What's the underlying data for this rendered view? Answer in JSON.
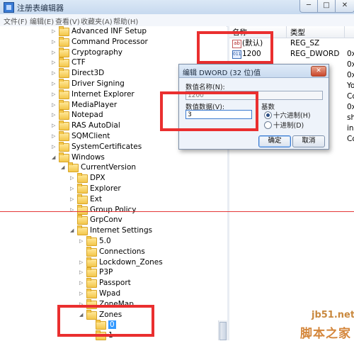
{
  "window": {
    "title": "注册表编辑器",
    "min": "─",
    "max": "□",
    "close": "✕"
  },
  "menu": [
    "文件(F)",
    "编辑(E)",
    "查看(V)",
    "收藏夹(A)",
    "帮助(H)"
  ],
  "tree": [
    {
      "label": "Advanced INF Setup",
      "exp": "▷"
    },
    {
      "label": "Command Processor",
      "exp": "▷"
    },
    {
      "label": "Cryptography",
      "exp": "▷"
    },
    {
      "label": "CTF",
      "exp": "▷"
    },
    {
      "label": "Direct3D",
      "exp": "▷"
    },
    {
      "label": "Driver Signing",
      "exp": "▷"
    },
    {
      "label": "Internet Explorer",
      "exp": "▷"
    },
    {
      "label": "MediaPlayer",
      "exp": "▷"
    },
    {
      "label": "Notepad",
      "exp": "▷"
    },
    {
      "label": "RAS AutoDial",
      "exp": "▷"
    },
    {
      "label": "SQMClient",
      "exp": "▷"
    },
    {
      "label": "SystemCertificates",
      "exp": "▷"
    },
    {
      "label": "Windows",
      "exp": "◢"
    },
    {
      "label": "CurrentVersion",
      "exp": "◢"
    },
    {
      "label": "DPX",
      "exp": "▷"
    },
    {
      "label": "Explorer",
      "exp": "▷"
    },
    {
      "label": "Ext",
      "exp": "▷"
    },
    {
      "label": "Group Policy",
      "exp": "▷"
    },
    {
      "label": "GrpConv",
      "exp": ""
    },
    {
      "label": "Internet Settings",
      "exp": "◢"
    },
    {
      "label": "5.0",
      "exp": "▷"
    },
    {
      "label": "Connections",
      "exp": ""
    },
    {
      "label": "Lockdown_Zones",
      "exp": "▷"
    },
    {
      "label": "P3P",
      "exp": "▷"
    },
    {
      "label": "Passport",
      "exp": "▷"
    },
    {
      "label": "Wpad",
      "exp": "▷"
    },
    {
      "label": "ZoneMap",
      "exp": "▷"
    },
    {
      "label": "Zones",
      "exp": "◢"
    },
    {
      "label": "0",
      "exp": ""
    },
    {
      "label": "1",
      "exp": ""
    }
  ],
  "list": {
    "headers": {
      "name": "名称",
      "type": "类型"
    },
    "rows": [
      {
        "icon": "ab",
        "name": "(默认)",
        "type": "REG_SZ",
        "data": ""
      },
      {
        "icon": "bin",
        "name": "1200",
        "type": "REG_DWORD",
        "data": "0x"
      },
      {
        "icon": "",
        "name": "",
        "type": "",
        "data": "0x"
      },
      {
        "icon": "",
        "name": "",
        "type": "",
        "data": "0x"
      },
      {
        "icon": "",
        "name": "",
        "type": "",
        "data": "Yo"
      },
      {
        "icon": "",
        "name": "",
        "type": "",
        "data": "Co"
      },
      {
        "icon": "",
        "name": "",
        "type": "",
        "data": "0x"
      },
      {
        "icon": "",
        "name": "",
        "type": "",
        "data": "sh"
      },
      {
        "icon": "",
        "name": "",
        "type": "",
        "data": "in"
      },
      {
        "icon": "",
        "name": "",
        "type": "",
        "data": "Co"
      }
    ]
  },
  "dialog": {
    "title": "编辑 DWORD (32 位)值",
    "close": "✕",
    "name_label": "数值名称(N):",
    "name_value": "1200",
    "data_label": "数值数据(V):",
    "data_value": "3",
    "base_label": "基数",
    "hex_label": "十六进制(H)",
    "dec_label": "十进制(D)",
    "ok": "确定",
    "cancel": "取消"
  },
  "watermark": {
    "site": "jb51.net",
    "brand": "脚本之家"
  },
  "colors": {
    "annotation": "#ea2f2f",
    "selection": "#3399ff"
  }
}
